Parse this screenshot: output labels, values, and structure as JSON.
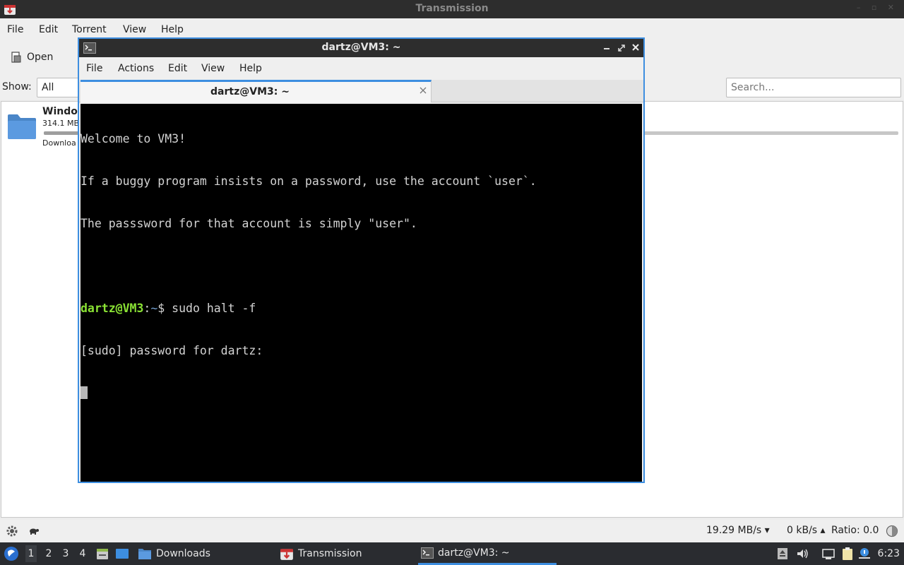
{
  "transmission": {
    "title": "Transmission",
    "menus": [
      "File",
      "Edit",
      "Torrent",
      "View",
      "Help"
    ],
    "toolbar": {
      "open_label": "Open"
    },
    "filter": {
      "show_label": "Show:",
      "show_value": "All",
      "search_placeholder": "Search..."
    },
    "torrent": {
      "name": "Window",
      "size": "314.1 MB",
      "status": "Downloa",
      "progress": 0.05
    },
    "statusbar": {
      "down_speed": "19.29 MB/s ▾",
      "up_speed": "0 kB/s ▴",
      "ratio": "Ratio: 0.0"
    }
  },
  "terminal": {
    "title": "dartz@VM3: ~",
    "menus": [
      "File",
      "Actions",
      "Edit",
      "View",
      "Help"
    ],
    "tab_label": "dartz@VM3: ~",
    "lines": [
      "Welcome to VM3!",
      "If a buggy program insists on a password, use the account `user`.",
      "The passsword for that account is simply \"user\"."
    ],
    "prompt": {
      "user_host": "dartz@VM3",
      "sep": ":",
      "path": "~",
      "symbol": "$",
      "command": "sudo halt -f"
    },
    "sudo_prompt": "[sudo] password for dartz:"
  },
  "taskbar": {
    "workspaces": [
      "1",
      "2",
      "3",
      "4"
    ],
    "tasks": {
      "downloads": "Downloads",
      "transmission": "Transmission",
      "terminal": "dartz@VM3: ~"
    },
    "clock": "6:23"
  },
  "colors": {
    "accent": "#3d8ee0",
    "prompt_green": "#8ae234",
    "prompt_blue": "#729fcf"
  }
}
